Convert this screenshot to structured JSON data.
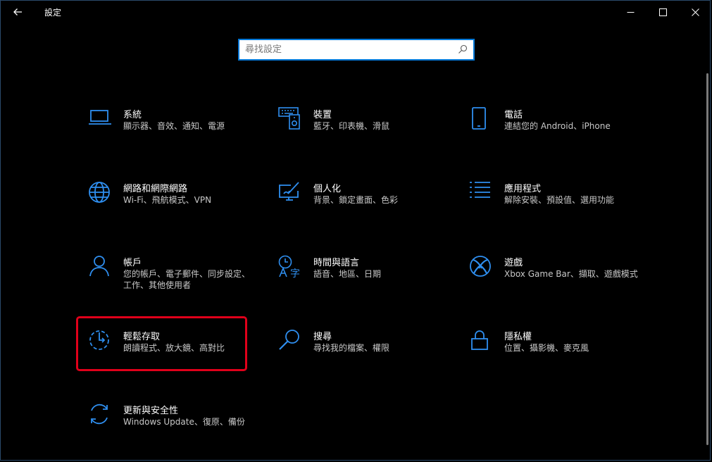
{
  "window": {
    "title": "設定",
    "back_icon": "back-arrow-icon",
    "minimize_icon": "minimize-icon",
    "maximize_icon": "maximize-icon",
    "close_icon": "close-icon"
  },
  "search": {
    "placeholder": "尋找設定",
    "value": "",
    "icon": "search-icon"
  },
  "accent_color": "#0078d7",
  "icon_color": "#2f8ff0",
  "highlight_color": "#e0001a",
  "tiles": [
    {
      "name": "系統",
      "desc": "顯示器、音效、通知、電源",
      "icon": "laptop-icon"
    },
    {
      "name": "裝置",
      "desc": "藍牙、印表機、滑鼠",
      "icon": "devices-icon"
    },
    {
      "name": "電話",
      "desc": "連結您的 Android、iPhone",
      "icon": "phone-icon"
    },
    {
      "name": "網路和網際網路",
      "desc": "Wi-Fi、飛航模式、VPN",
      "icon": "globe-icon"
    },
    {
      "name": "個人化",
      "desc": "背景、鎖定畫面、色彩",
      "icon": "personalization-icon"
    },
    {
      "name": "應用程式",
      "desc": "解除安裝、預設值、選用功能",
      "icon": "apps-list-icon"
    },
    {
      "name": "帳戶",
      "desc": "您的帳戶、電子郵件、同步設定、工作、其他使用者",
      "icon": "person-icon"
    },
    {
      "name": "時間與語言",
      "desc": "語音、地區、日期",
      "icon": "time-language-icon"
    },
    {
      "name": "遊戲",
      "desc": "Xbox Game Bar、擷取、遊戲模式",
      "icon": "xbox-icon"
    },
    {
      "name": "輕鬆存取",
      "desc": "朗讀程式、放大鏡、高對比",
      "icon": "ease-of-access-icon"
    },
    {
      "name": "搜尋",
      "desc": "尋找我的檔案、權限",
      "icon": "search-magnifier-icon"
    },
    {
      "name": "隱私權",
      "desc": "位置、攝影機、麥克風",
      "icon": "lock-icon"
    },
    {
      "name": "更新與安全性",
      "desc": "Windows Update、復原、備份",
      "icon": "update-sync-icon"
    }
  ]
}
